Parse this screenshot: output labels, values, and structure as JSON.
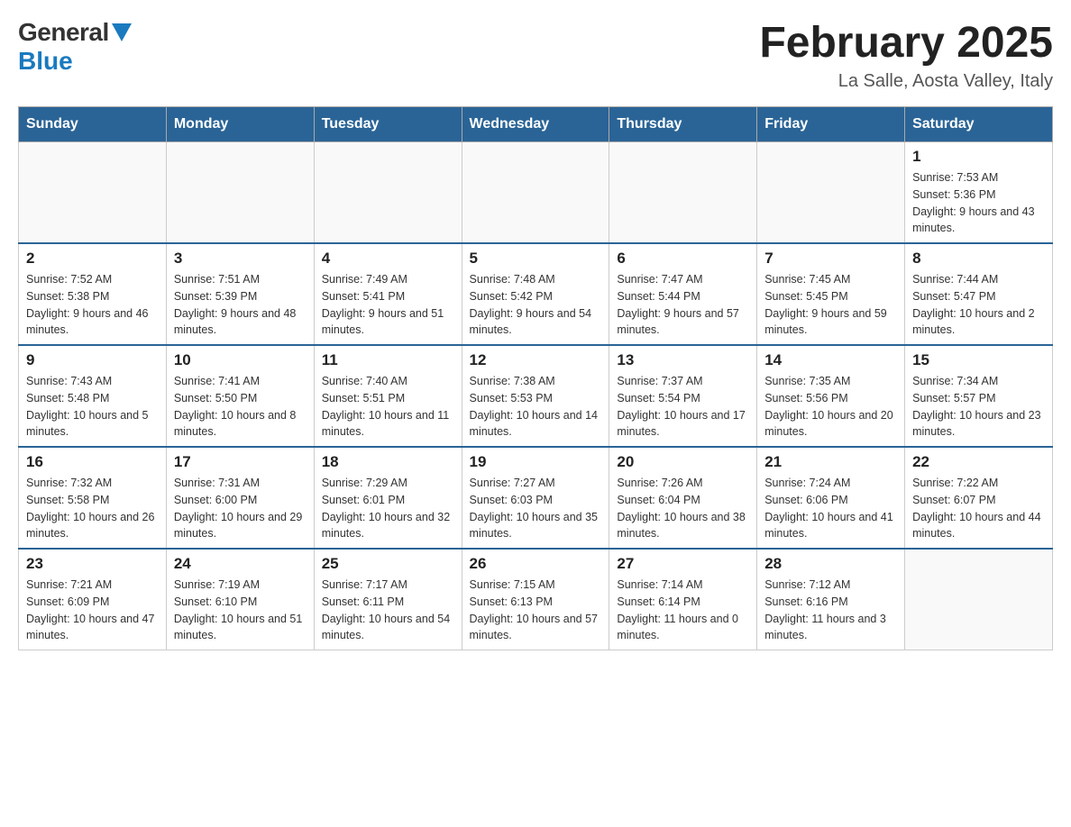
{
  "header": {
    "logo_general": "General",
    "logo_blue": "Blue",
    "title": "February 2025",
    "subtitle": "La Salle, Aosta Valley, Italy"
  },
  "weekdays": [
    "Sunday",
    "Monday",
    "Tuesday",
    "Wednesday",
    "Thursday",
    "Friday",
    "Saturday"
  ],
  "weeks": [
    [
      {
        "day": "",
        "info": ""
      },
      {
        "day": "",
        "info": ""
      },
      {
        "day": "",
        "info": ""
      },
      {
        "day": "",
        "info": ""
      },
      {
        "day": "",
        "info": ""
      },
      {
        "day": "",
        "info": ""
      },
      {
        "day": "1",
        "info": "Sunrise: 7:53 AM\nSunset: 5:36 PM\nDaylight: 9 hours and 43 minutes."
      }
    ],
    [
      {
        "day": "2",
        "info": "Sunrise: 7:52 AM\nSunset: 5:38 PM\nDaylight: 9 hours and 46 minutes."
      },
      {
        "day": "3",
        "info": "Sunrise: 7:51 AM\nSunset: 5:39 PM\nDaylight: 9 hours and 48 minutes."
      },
      {
        "day": "4",
        "info": "Sunrise: 7:49 AM\nSunset: 5:41 PM\nDaylight: 9 hours and 51 minutes."
      },
      {
        "day": "5",
        "info": "Sunrise: 7:48 AM\nSunset: 5:42 PM\nDaylight: 9 hours and 54 minutes."
      },
      {
        "day": "6",
        "info": "Sunrise: 7:47 AM\nSunset: 5:44 PM\nDaylight: 9 hours and 57 minutes."
      },
      {
        "day": "7",
        "info": "Sunrise: 7:45 AM\nSunset: 5:45 PM\nDaylight: 9 hours and 59 minutes."
      },
      {
        "day": "8",
        "info": "Sunrise: 7:44 AM\nSunset: 5:47 PM\nDaylight: 10 hours and 2 minutes."
      }
    ],
    [
      {
        "day": "9",
        "info": "Sunrise: 7:43 AM\nSunset: 5:48 PM\nDaylight: 10 hours and 5 minutes."
      },
      {
        "day": "10",
        "info": "Sunrise: 7:41 AM\nSunset: 5:50 PM\nDaylight: 10 hours and 8 minutes."
      },
      {
        "day": "11",
        "info": "Sunrise: 7:40 AM\nSunset: 5:51 PM\nDaylight: 10 hours and 11 minutes."
      },
      {
        "day": "12",
        "info": "Sunrise: 7:38 AM\nSunset: 5:53 PM\nDaylight: 10 hours and 14 minutes."
      },
      {
        "day": "13",
        "info": "Sunrise: 7:37 AM\nSunset: 5:54 PM\nDaylight: 10 hours and 17 minutes."
      },
      {
        "day": "14",
        "info": "Sunrise: 7:35 AM\nSunset: 5:56 PM\nDaylight: 10 hours and 20 minutes."
      },
      {
        "day": "15",
        "info": "Sunrise: 7:34 AM\nSunset: 5:57 PM\nDaylight: 10 hours and 23 minutes."
      }
    ],
    [
      {
        "day": "16",
        "info": "Sunrise: 7:32 AM\nSunset: 5:58 PM\nDaylight: 10 hours and 26 minutes."
      },
      {
        "day": "17",
        "info": "Sunrise: 7:31 AM\nSunset: 6:00 PM\nDaylight: 10 hours and 29 minutes."
      },
      {
        "day": "18",
        "info": "Sunrise: 7:29 AM\nSunset: 6:01 PM\nDaylight: 10 hours and 32 minutes."
      },
      {
        "day": "19",
        "info": "Sunrise: 7:27 AM\nSunset: 6:03 PM\nDaylight: 10 hours and 35 minutes."
      },
      {
        "day": "20",
        "info": "Sunrise: 7:26 AM\nSunset: 6:04 PM\nDaylight: 10 hours and 38 minutes."
      },
      {
        "day": "21",
        "info": "Sunrise: 7:24 AM\nSunset: 6:06 PM\nDaylight: 10 hours and 41 minutes."
      },
      {
        "day": "22",
        "info": "Sunrise: 7:22 AM\nSunset: 6:07 PM\nDaylight: 10 hours and 44 minutes."
      }
    ],
    [
      {
        "day": "23",
        "info": "Sunrise: 7:21 AM\nSunset: 6:09 PM\nDaylight: 10 hours and 47 minutes."
      },
      {
        "day": "24",
        "info": "Sunrise: 7:19 AM\nSunset: 6:10 PM\nDaylight: 10 hours and 51 minutes."
      },
      {
        "day": "25",
        "info": "Sunrise: 7:17 AM\nSunset: 6:11 PM\nDaylight: 10 hours and 54 minutes."
      },
      {
        "day": "26",
        "info": "Sunrise: 7:15 AM\nSunset: 6:13 PM\nDaylight: 10 hours and 57 minutes."
      },
      {
        "day": "27",
        "info": "Sunrise: 7:14 AM\nSunset: 6:14 PM\nDaylight: 11 hours and 0 minutes."
      },
      {
        "day": "28",
        "info": "Sunrise: 7:12 AM\nSunset: 6:16 PM\nDaylight: 11 hours and 3 minutes."
      },
      {
        "day": "",
        "info": ""
      }
    ]
  ]
}
